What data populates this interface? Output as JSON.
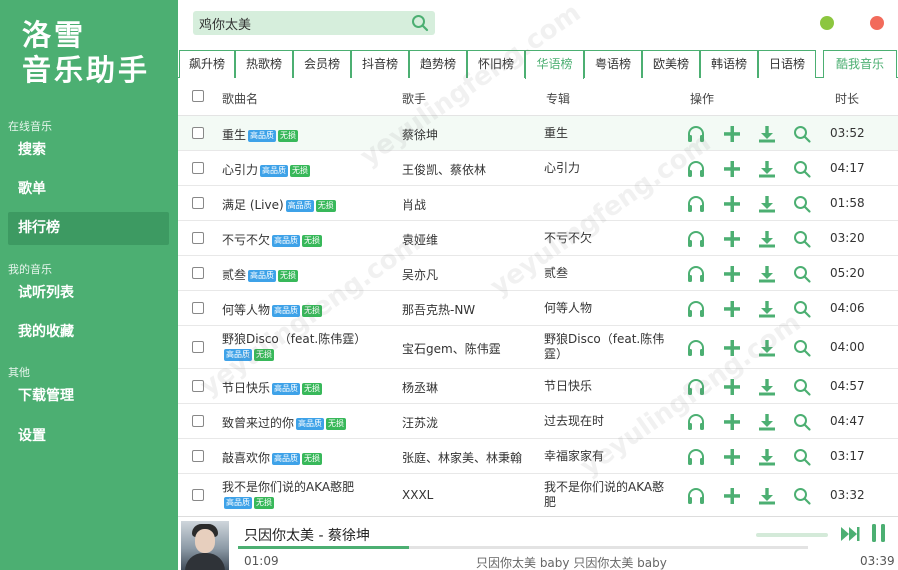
{
  "app": {
    "title_line1": "洛雪",
    "title_line2": "音乐助手"
  },
  "sidebar": {
    "sections": [
      {
        "label": "在线音乐",
        "items": [
          {
            "label": "搜索"
          },
          {
            "label": "歌单"
          },
          {
            "label": "排行榜",
            "active": true
          }
        ]
      },
      {
        "label": "我的音乐",
        "items": [
          {
            "label": "试听列表"
          },
          {
            "label": "我的收藏"
          }
        ]
      },
      {
        "label": "其他",
        "items": [
          {
            "label": "下载管理"
          },
          {
            "label": "设置"
          }
        ]
      }
    ]
  },
  "search": {
    "value": "鸡你太美",
    "icon": "search-icon"
  },
  "window_controls": {
    "minimize_color": "#8cc63f",
    "close_color": "#f26b5b"
  },
  "tabs": [
    "飙升榜",
    "热歌榜",
    "会员榜",
    "抖音榜",
    "趋势榜",
    "怀旧榜",
    "华语榜",
    "粤语榜",
    "欧美榜",
    "韩语榜",
    "日语榜"
  ],
  "active_tab": "华语榜",
  "source_tab": "酷我音乐",
  "table": {
    "headers": {
      "name": "歌曲名",
      "singer": "歌手",
      "album": "专辑",
      "actions": "操作",
      "duration": "时长"
    },
    "badges": {
      "hq": "高品质",
      "lossless": "无损"
    },
    "rows": [
      {
        "name": "重生",
        "singer": "蔡徐坤",
        "album": "重生",
        "duration": "03:52"
      },
      {
        "name": "心引力",
        "singer": "王俊凯、蔡依林",
        "album": "心引力",
        "duration": "04:17"
      },
      {
        "name": "满足 (Live)",
        "singer": "肖战",
        "album": "",
        "duration": "01:58"
      },
      {
        "name": "不亏不欠",
        "singer": "袁娅维",
        "album": "不亏不欠",
        "duration": "03:20"
      },
      {
        "name": "贰叁",
        "singer": "吴亦凡",
        "album": "贰叁",
        "duration": "05:20"
      },
      {
        "name": "何等人物",
        "singer": "那吾克热-NW",
        "album": "何等人物",
        "duration": "04:06"
      },
      {
        "name": "野狼Disco（feat.陈伟霆）",
        "singer": "宝石gem、陈伟霆",
        "album": "野狼Disco（feat.陈伟霆）",
        "duration": "04:00"
      },
      {
        "name": "节日快乐",
        "singer": "杨丞琳",
        "album": "节日快乐",
        "duration": "04:57"
      },
      {
        "name": "致曾来过的你",
        "singer": "汪苏泷",
        "album": "过去现在时",
        "duration": "04:47"
      },
      {
        "name": "敲喜欢你",
        "singer": "张庭、林家美、林秉翰",
        "album": "幸福家家有",
        "duration": "03:17"
      },
      {
        "name": "我不是你们说的AKA憨肥",
        "singer": "XXXL",
        "album": "我不是你们说的AKA憨肥",
        "duration": "03:32"
      }
    ]
  },
  "player": {
    "now_playing": "只因你太美 - 蔡徐坤",
    "current_time": "01:09",
    "lyric": "只因你太美 baby 只因你太美 baby",
    "total_time": "03:39",
    "progress_fraction": 0.3
  },
  "colors": {
    "accent": "#4caf72",
    "hq_badge": "#3ea2e8",
    "lossless_badge": "#38b85a"
  },
  "watermark": "yeyulingfeng.com"
}
